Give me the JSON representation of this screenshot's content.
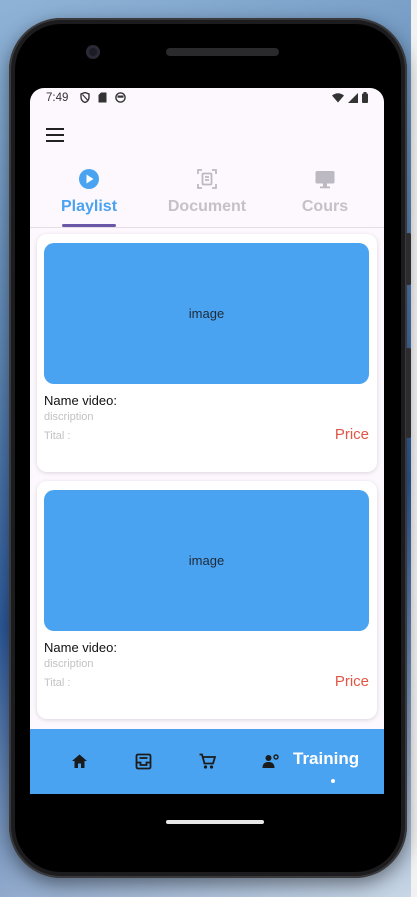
{
  "status_bar": {
    "time": "7:49"
  },
  "tabs": [
    {
      "label": "Playlist",
      "icon": "play-circle-icon",
      "active": true
    },
    {
      "label": "Document",
      "icon": "document-scan-icon",
      "active": false
    },
    {
      "label": "Cours",
      "icon": "monitor-icon",
      "active": false
    }
  ],
  "cards": [
    {
      "image_label": "image",
      "name": "Name video:",
      "description": "discription",
      "tital": "Tital :",
      "price": "Price"
    },
    {
      "image_label": "image",
      "name": "Name video:",
      "description": "discription",
      "tital": "Tital :",
      "price": "Price"
    }
  ],
  "bottom_nav": {
    "items": [
      "home-icon",
      "inbox-icon",
      "cart-icon",
      "person-settings-icon"
    ],
    "active_label": "Training"
  },
  "colors": {
    "accent": "#4aa3f0",
    "price": "#e05645",
    "indicator": "#6b57a8",
    "background": "#fdf7fe"
  }
}
